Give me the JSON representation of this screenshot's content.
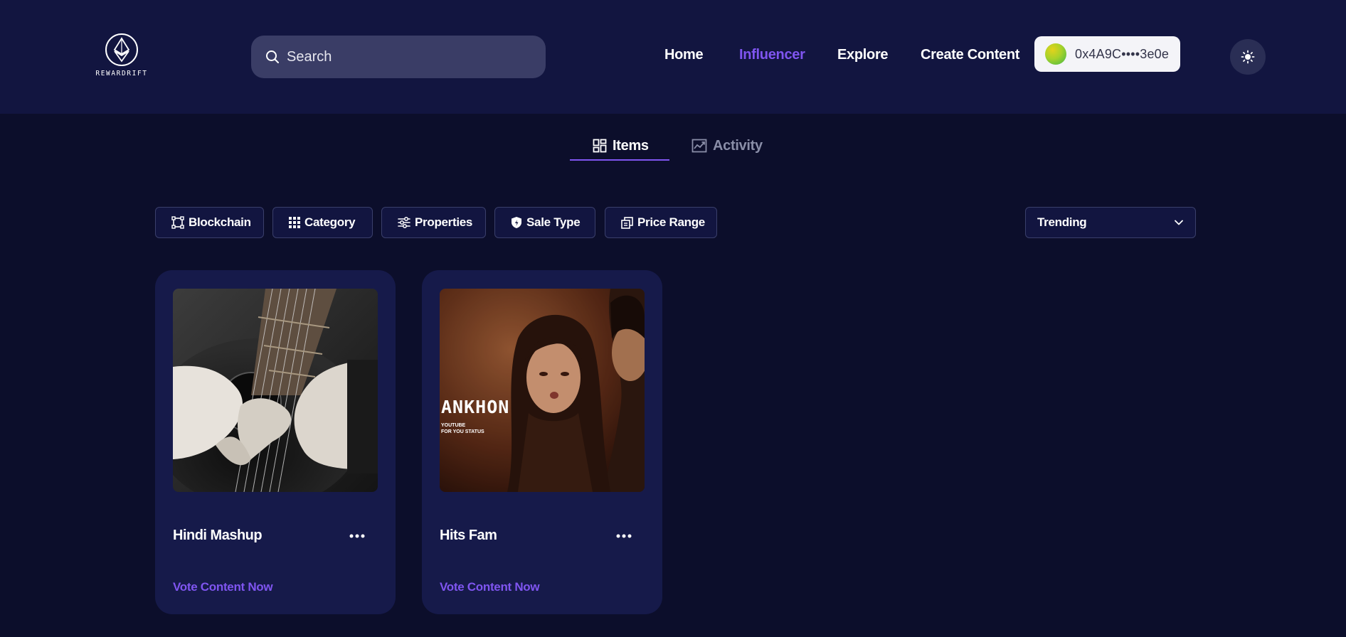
{
  "brand": {
    "name": "REWARDRIFT"
  },
  "search": {
    "placeholder": "Search"
  },
  "nav": [
    {
      "label": "Home",
      "active": false
    },
    {
      "label": "Influencer",
      "active": true
    },
    {
      "label": "Explore",
      "active": false
    },
    {
      "label": "Create Content",
      "active": false
    }
  ],
  "wallet": {
    "address": "0x4A9C••••3e0e"
  },
  "tabs": [
    {
      "label": "Items",
      "icon": "grid-icon",
      "active": true
    },
    {
      "label": "Activity",
      "icon": "chart-icon",
      "active": false
    }
  ],
  "filters": [
    {
      "label": "Blockchain",
      "icon": "blockchain-icon"
    },
    {
      "label": "Category",
      "icon": "category-grid-icon"
    },
    {
      "label": "Properties",
      "icon": "sliders-icon"
    },
    {
      "label": "Sale Type",
      "icon": "shield-icon"
    },
    {
      "label": "Price Range",
      "icon": "copy-icon"
    }
  ],
  "sort": {
    "selected": "Trending"
  },
  "cards": [
    {
      "title": "Hindi Mashup",
      "cta": "Vote Content Now",
      "image": "guitar-heart-photo"
    },
    {
      "title": "Hits Fam",
      "cta": "Vote Content Now",
      "image": "ankhon-poster",
      "poster_title": "ANKHON",
      "poster_subtitle_1": "YOUTUBE",
      "poster_subtitle_2": "FOR YOU STATUS"
    }
  ],
  "colors": {
    "background": "#0c0e2b",
    "header": "#121540",
    "accent": "#7f55f0",
    "card": "#161a4a"
  }
}
